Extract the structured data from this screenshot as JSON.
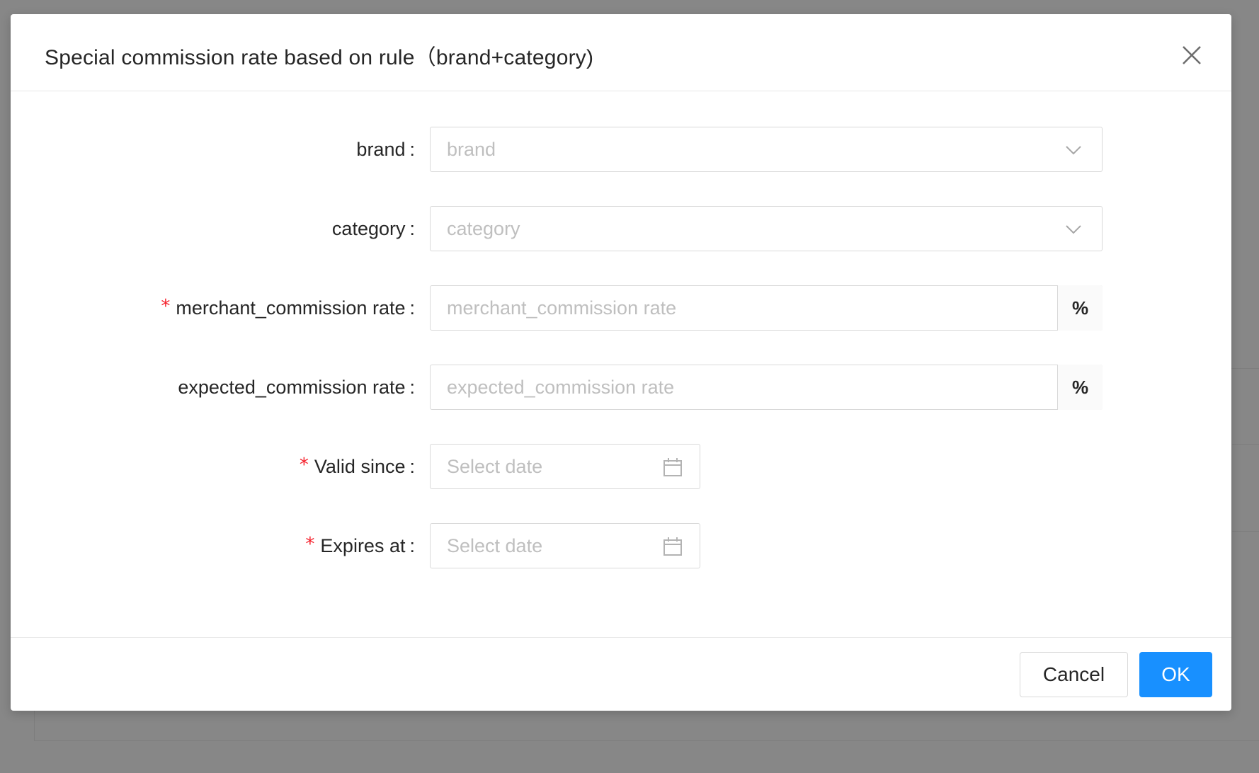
{
  "modal": {
    "title": "Special commission rate based on rule（brand+category)"
  },
  "form": {
    "brand": {
      "label": "brand",
      "placeholder": "brand",
      "required": false
    },
    "category": {
      "label": "category",
      "placeholder": "category",
      "required": false
    },
    "merchant_rate": {
      "label": "merchant_commission rate",
      "placeholder": "merchant_commission rate",
      "addon": "%",
      "required": true
    },
    "expected_rate": {
      "label": "expected_commission rate",
      "placeholder": "expected_commission rate",
      "addon": "%",
      "required": false
    },
    "valid_since": {
      "label": "Valid since",
      "placeholder": "Select date",
      "required": true
    },
    "expires_at": {
      "label": "Expires at",
      "placeholder": "Select date",
      "required": true
    },
    "colon": ":",
    "required_mark": "*"
  },
  "footer": {
    "cancel_label": "Cancel",
    "ok_label": "OK"
  },
  "colors": {
    "primary": "#1890ff",
    "required": "#f5222d",
    "overlay": "#878787",
    "placeholder": "#bfbfbf"
  },
  "icons": {
    "close": "close-icon",
    "dropdown": "chevron-down-icon",
    "date": "calendar-icon"
  }
}
